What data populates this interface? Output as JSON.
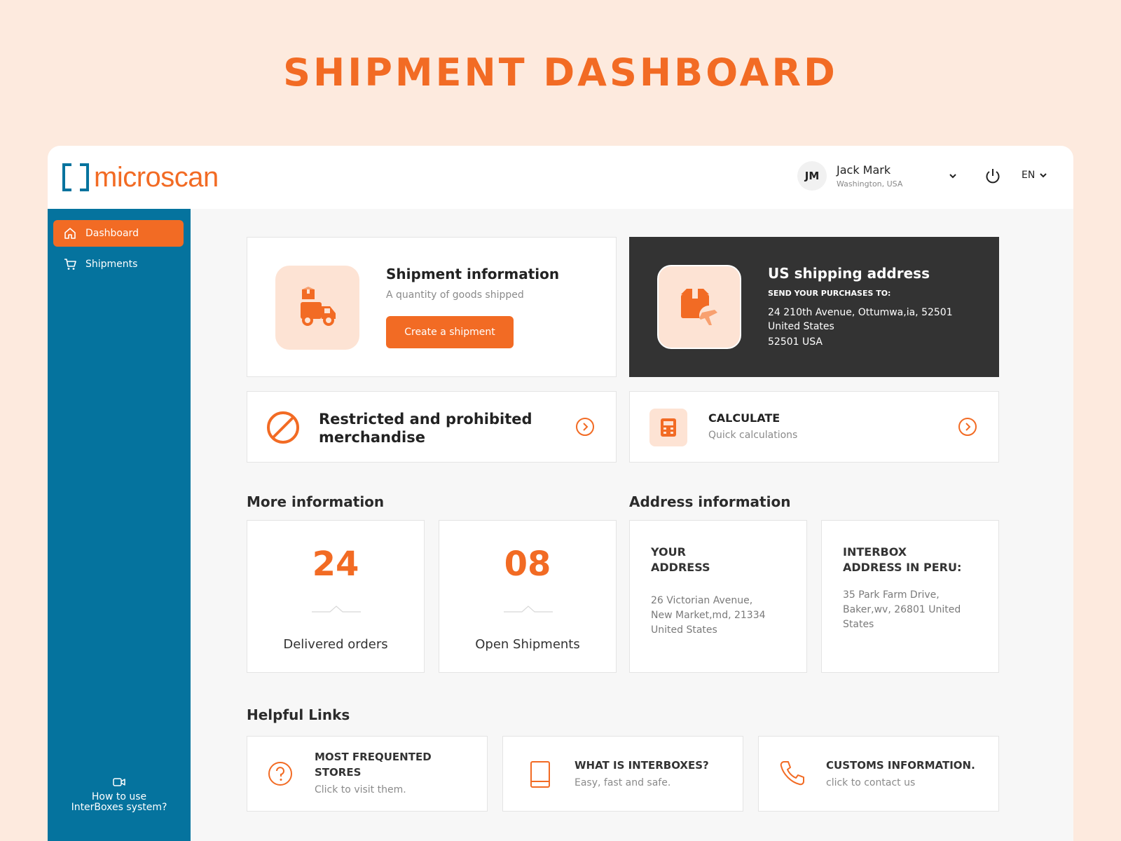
{
  "page_title": "SHIPMENT DASHBOARD",
  "brand": {
    "logo_text": "microscan",
    "primary_color": "#f26b24",
    "sidebar_color": "#05739e"
  },
  "header": {
    "user": {
      "initials": "JM",
      "name": "Jack Mark",
      "location": "Washington, USA"
    },
    "language": "EN"
  },
  "sidebar": {
    "items": [
      {
        "label": "Dashboard",
        "icon": "home-icon",
        "active": true
      },
      {
        "label": "Shipments",
        "icon": "cart-icon",
        "active": false
      }
    ],
    "help": {
      "line1": "How to use",
      "line2": "InterBoxes system?",
      "icon": "video-icon"
    }
  },
  "shipment_info": {
    "title": "Shipment information",
    "subtitle": "A quantity of goods shipped",
    "button": "Create a shipment",
    "icon": "delivery-truck-icon"
  },
  "us_address": {
    "title": "US shipping address",
    "label": "SEND YOUR PURCHASES TO:",
    "line1": "24 210th Avenue, Ottumwa,ia, 52501",
    "line2": "United States",
    "line3": "52501 USA",
    "icon": "package-plane-icon"
  },
  "restricted": {
    "line1": "Restricted and prohibited",
    "line2": "merchandise",
    "icon": "prohibited-icon"
  },
  "calculate": {
    "title": "CALCULATE",
    "subtitle": "Quick calculations",
    "icon": "calculator-icon"
  },
  "more_info": {
    "title": "More information",
    "stats": [
      {
        "value": "24",
        "label": "Delivered orders"
      },
      {
        "value": "08",
        "label": "Open Shipments"
      }
    ]
  },
  "address_info": {
    "title": "Address information",
    "your_address": {
      "title1": "YOUR",
      "title2": "ADDRESS",
      "line1": "26 Victorian Avenue,",
      "line2": "New Market,md, 21334",
      "line3": "United States"
    },
    "interbox_address": {
      "title1": "INTERBOX",
      "title2": "ADDRESS IN PERU:",
      "line1": "35 Park Farm Drive,",
      "line2": "Baker,wv, 26801  United",
      "line3": "States"
    }
  },
  "helpful_links": {
    "title": "Helpful Links",
    "links": [
      {
        "title1": "MOST FREQUENTED",
        "title2": "STORES",
        "subtitle": "Click to visit them.",
        "icon": "question-circle-icon"
      },
      {
        "title1": "WHAT IS INTERBOXES?",
        "subtitle": "Easy, fast and safe.",
        "icon": "book-icon"
      },
      {
        "title1": "CUSTOMS INFORMATION.",
        "subtitle": "click to contact us",
        "icon": "phone-icon"
      }
    ]
  }
}
